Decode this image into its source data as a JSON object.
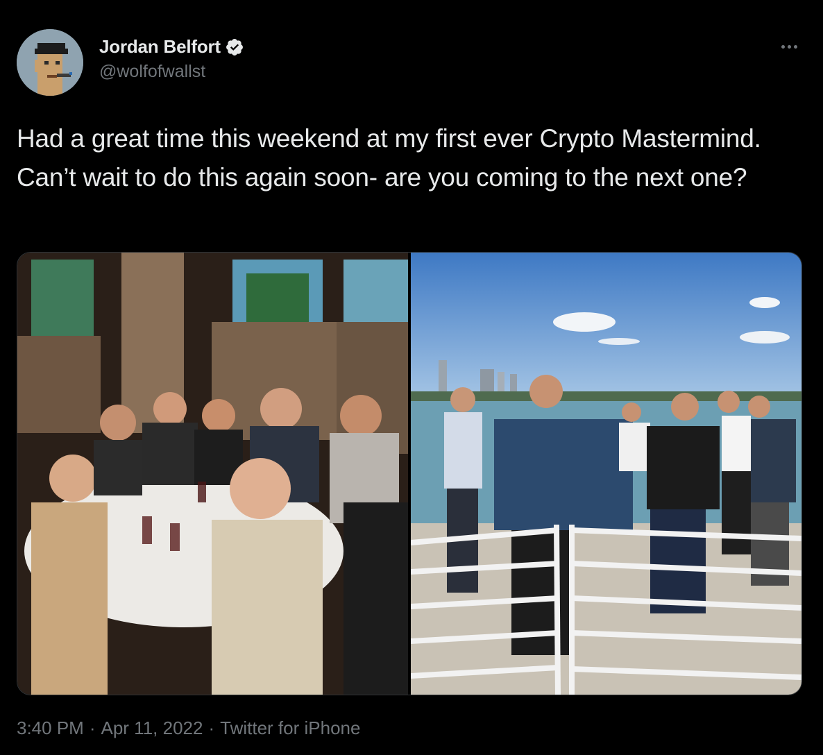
{
  "author": {
    "display_name": "Jordan Belfort",
    "handle": "@wolfofwallst",
    "verified": true,
    "avatar_icon": "pixel-punk-avatar"
  },
  "tweet": {
    "text": "Had a great time this weekend at my first ever Crypto Mastermind. Can’t wait to do this again soon- are you coming to the next one?"
  },
  "media": {
    "photos": [
      {
        "description_icon": "restaurant-group-photo"
      },
      {
        "description_icon": "waterfront-group-photo"
      }
    ]
  },
  "meta": {
    "time": "3:40 PM",
    "separator": "·",
    "date": "Apr 11, 2022",
    "source": "Twitter for iPhone"
  },
  "colors": {
    "background": "#000000",
    "text": "#e7e9ea",
    "secondary": "#71767b",
    "verified_badge": "#e7e9ea"
  }
}
